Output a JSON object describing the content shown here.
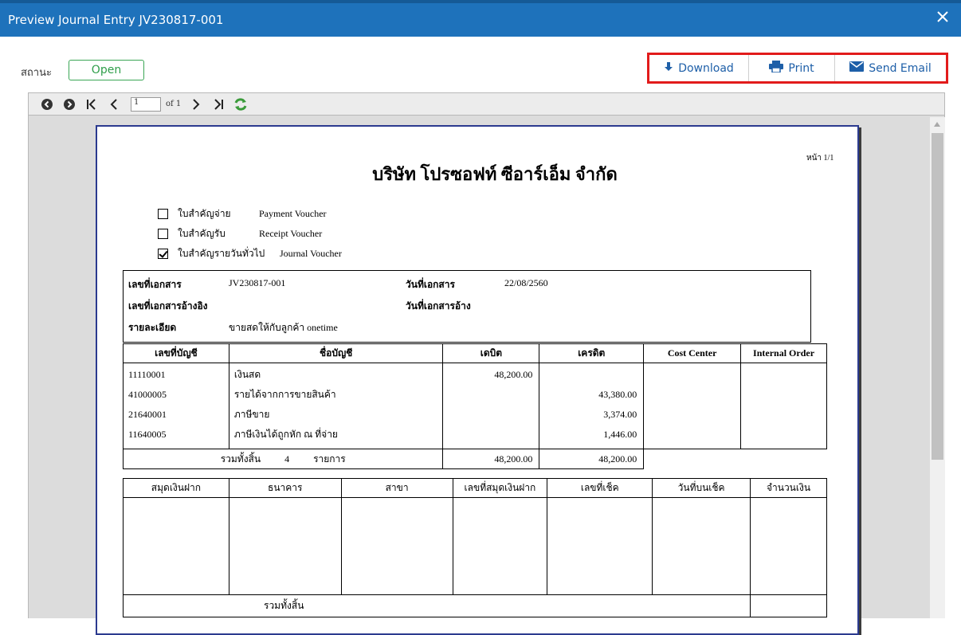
{
  "dialog": {
    "title": "Preview Journal Entry JV230817-001",
    "close_label": "close"
  },
  "status": {
    "label": "สถานะ",
    "value": "Open"
  },
  "actions": {
    "download": "Download",
    "print": "Print",
    "send_email": "Send Email"
  },
  "viewer_toolbar": {
    "current_page": "1",
    "of_label": "of 1"
  },
  "report": {
    "page_no": "หน้า 1/1",
    "company": "บริษัท โปรซอฟท์ ซีอาร์เอ็ม จำกัด",
    "vouchers": [
      {
        "th": "ใบสำคัญจ่าย",
        "en": "Payment Voucher",
        "checked": false
      },
      {
        "th": "ใบสำคัญรับ",
        "en": "Receipt Voucher",
        "checked": false
      },
      {
        "th": "ใบสำคัญรายวันทั่วไป",
        "en": "Journal Voucher",
        "checked": true
      }
    ],
    "info": {
      "doc_no_label": "เลขที่เอกสาร",
      "doc_no": "JV230817-001",
      "doc_date_label": "วันที่เอกสาร",
      "doc_date": "22/08/2560",
      "ref_doc_label": "เลขที่เอกสารอ้างอิง",
      "ref_date_label": "วันที่เอกสารอ้าง",
      "detail_label": "รายละเอียด",
      "detail": "ขายสดให้กับลูกค้า onetime"
    },
    "entry_headers": {
      "account_no": "เลขที่บัญชี",
      "account_name": "ชื่อบัญชี",
      "debit": "เดบิต",
      "credit": "เครดิต",
      "cost_center": "Cost Center",
      "internal_order": "Internal Order"
    },
    "entries": [
      {
        "account_no": "11110001",
        "account_name": "เงินสด",
        "debit": "48,200.00",
        "credit": ""
      },
      {
        "account_no": "41000005",
        "account_name": "รายได้จากการขายสินค้า",
        "debit": "",
        "credit": "43,380.00"
      },
      {
        "account_no": "21640001",
        "account_name": "ภาษีขาย",
        "debit": "",
        "credit": "3,374.00"
      },
      {
        "account_no": "11640005",
        "account_name": "ภาษีเงินได้ถูกหัก ณ ที่จ่าย",
        "debit": "",
        "credit": "1,446.00"
      }
    ],
    "totals": {
      "label": "รวมทั้งสิ้น",
      "count": "4",
      "unit": "รายการ",
      "debit": "48,200.00",
      "credit": "48,200.00"
    },
    "bank_headers": {
      "bankbook": "สมุดเงินฝาก",
      "bank": "ธนาคาร",
      "branch": "สาขา",
      "bankbook_no": "เลขที่สมุดเงินฝาก",
      "cheque_no": "เลขที่เช็ค",
      "cheque_date": "วันที่บนเช็ค",
      "amount": "จำนวนเงิน"
    },
    "bank_total_label": "รวมทั้งสิ้น"
  },
  "colors": {
    "titlebar": "#1e72bb",
    "status_green": "#2f9e4a",
    "action_highlight": "#e21b1b",
    "action_text": "#1e5fa8",
    "page_border": "#2b3a8f"
  }
}
